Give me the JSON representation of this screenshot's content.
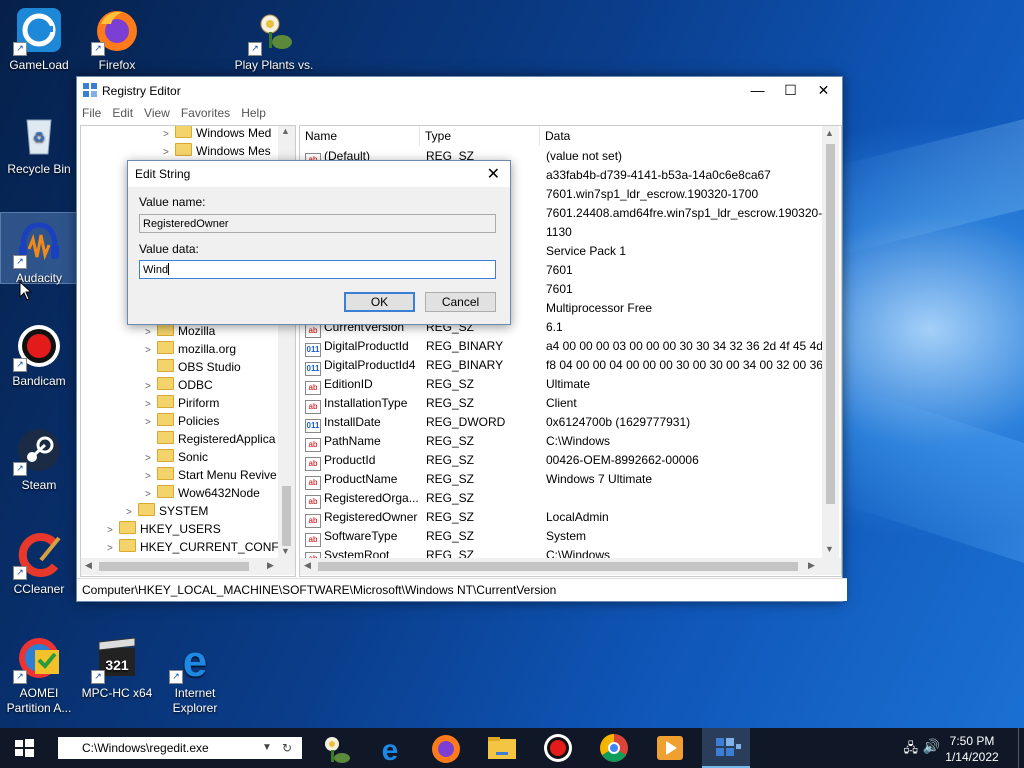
{
  "desktop": {
    "icons": [
      {
        "label": "GameLoad"
      },
      {
        "label": "Firefox"
      },
      {
        "label": "Play Plants vs."
      },
      {
        "label": "Recycle Bin"
      },
      {
        "label": "Audacity"
      },
      {
        "label": "Bandicam"
      },
      {
        "label": "Steam"
      },
      {
        "label": "CCleaner"
      },
      {
        "label": "AOMEI Partition A..."
      },
      {
        "label": "MPC-HC x64"
      },
      {
        "label": "Internet Explorer"
      }
    ]
  },
  "regedit": {
    "title": "Registry Editor",
    "menu": [
      "File",
      "Edit",
      "View",
      "Favorites",
      "Help"
    ],
    "tree": [
      {
        "label": "Windows Med",
        "arrow": ">"
      },
      {
        "label": "Windows Mes",
        "arrow": ">"
      },
      {
        "label": "Mozilla",
        "arrow": ">"
      },
      {
        "label": "mozilla.org",
        "arrow": ">"
      },
      {
        "label": "OBS Studio",
        "arrow": ""
      },
      {
        "label": "ODBC",
        "arrow": ">"
      },
      {
        "label": "Piriform",
        "arrow": ">"
      },
      {
        "label": "Policies",
        "arrow": ">"
      },
      {
        "label": "RegisteredApplica",
        "arrow": ""
      },
      {
        "label": "Sonic",
        "arrow": ">"
      },
      {
        "label": "Start Menu Revive",
        "arrow": ">"
      },
      {
        "label": "Wow6432Node",
        "arrow": ">"
      },
      {
        "label": "SYSTEM",
        "arrow": ">"
      },
      {
        "label": "HKEY_USERS",
        "arrow": ">"
      },
      {
        "label": "HKEY_CURRENT_CONFIG",
        "arrow": ">"
      }
    ],
    "columns": [
      "Name",
      "Type",
      "Data"
    ],
    "rows": [
      {
        "name": "(Default)",
        "type": "REG_SZ",
        "data": "(value not set)",
        "kind": "sz"
      },
      {
        "name": "",
        "type": "",
        "data": "a33fab4b-d739-4141-b53a-14a0c6e8ca67",
        "kind": "sz"
      },
      {
        "name": "",
        "type": "",
        "data": "7601.win7sp1_ldr_escrow.190320-1700",
        "kind": "sz"
      },
      {
        "name": "",
        "type": "",
        "data": "7601.24408.amd64fre.win7sp1_ldr_escrow.190320-1...",
        "kind": "sz"
      },
      {
        "name": "",
        "type": "",
        "data": "1130",
        "kind": "sz"
      },
      {
        "name": "",
        "type": "",
        "data": "Service Pack 1",
        "kind": "sz"
      },
      {
        "name": "",
        "type": "",
        "data": "7601",
        "kind": "sz"
      },
      {
        "name": "",
        "type": "",
        "data": "7601",
        "kind": "sz"
      },
      {
        "name": "",
        "type": "",
        "data": "Multiprocessor Free",
        "kind": "sz"
      },
      {
        "name": "CurrentVersion",
        "type": "REG_SZ",
        "data": "6.1",
        "kind": "sz"
      },
      {
        "name": "DigitalProductId",
        "type": "REG_BINARY",
        "data": "a4 00 00 00 03 00 00 00 30 30 34 32 36 2d 4f 45 4d 2...",
        "kind": "bin"
      },
      {
        "name": "DigitalProductId4",
        "type": "REG_BINARY",
        "data": "f8 04 00 00 04 00 00 00 30 00 30 00 34 00 32 00 36 00...",
        "kind": "bin"
      },
      {
        "name": "EditionID",
        "type": "REG_SZ",
        "data": "Ultimate",
        "kind": "sz"
      },
      {
        "name": "InstallationType",
        "type": "REG_SZ",
        "data": "Client",
        "kind": "sz"
      },
      {
        "name": "InstallDate",
        "type": "REG_DWORD",
        "data": "0x6124700b (1629777931)",
        "kind": "bin"
      },
      {
        "name": "PathName",
        "type": "REG_SZ",
        "data": "C:\\Windows",
        "kind": "sz"
      },
      {
        "name": "ProductId",
        "type": "REG_SZ",
        "data": "00426-OEM-8992662-00006",
        "kind": "sz"
      },
      {
        "name": "ProductName",
        "type": "REG_SZ",
        "data": "Windows 7 Ultimate",
        "kind": "sz"
      },
      {
        "name": "RegisteredOrga...",
        "type": "REG_SZ",
        "data": "",
        "kind": "sz"
      },
      {
        "name": "RegisteredOwner",
        "type": "REG_SZ",
        "data": "LocalAdmin",
        "kind": "sz"
      },
      {
        "name": "SoftwareType",
        "type": "REG_SZ",
        "data": "System",
        "kind": "sz"
      },
      {
        "name": "SystemRoot",
        "type": "REG_SZ",
        "data": "C:\\Windows",
        "kind": "sz"
      }
    ],
    "status_path": "Computer\\HKEY_LOCAL_MACHINE\\SOFTWARE\\Microsoft\\Windows NT\\CurrentVersion"
  },
  "dialog": {
    "title": "Edit String",
    "value_name_label": "Value name:",
    "value_name": "RegisteredOwner",
    "value_data_label": "Value data:",
    "value_data": "Wind",
    "ok_label": "OK",
    "cancel_label": "Cancel"
  },
  "taskbar": {
    "run_path": "C:\\Windows\\regedit.exe",
    "time": "7:50 PM",
    "date": "1/14/2022"
  },
  "colors": {
    "accent": "#3b7fd6",
    "taskbar": "#101827",
    "folder": "#f4d36b"
  }
}
